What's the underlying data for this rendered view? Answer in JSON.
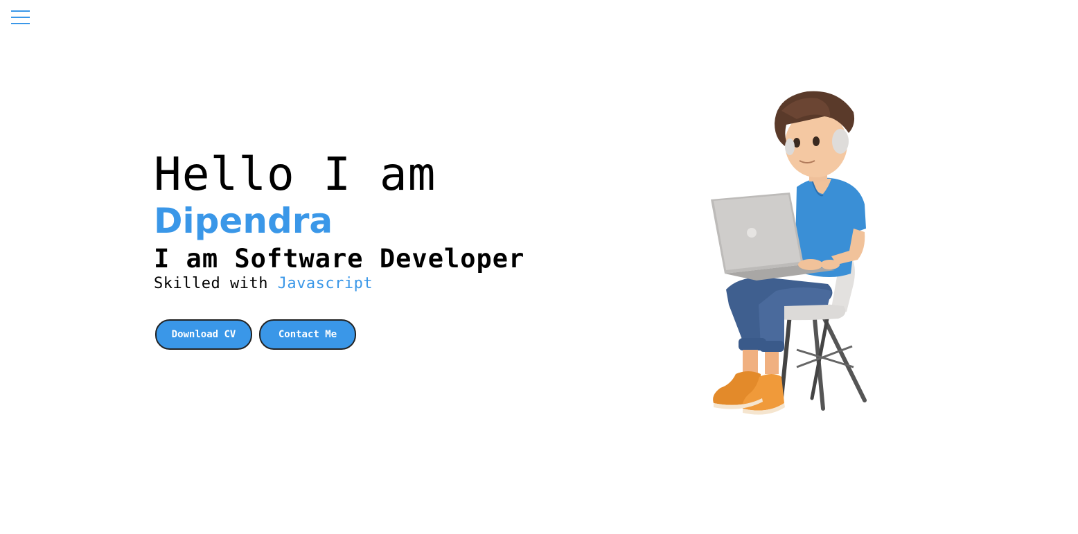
{
  "nav": {
    "menu_icon": "hamburger-menu-icon"
  },
  "hero": {
    "greeting": "Hello I am",
    "name": "Dipendra",
    "role": "I am Software Developer",
    "skills_prefix": "Skilled with ",
    "skills_highlight": "Javascript"
  },
  "actions": {
    "download_cv_label": "Download CV",
    "contact_label": "Contact Me"
  },
  "illustration": {
    "description_icon": "developer-with-laptop-illustration"
  },
  "colors": {
    "accent": "#3a97e8",
    "text": "#000000",
    "background": "#ffffff"
  }
}
